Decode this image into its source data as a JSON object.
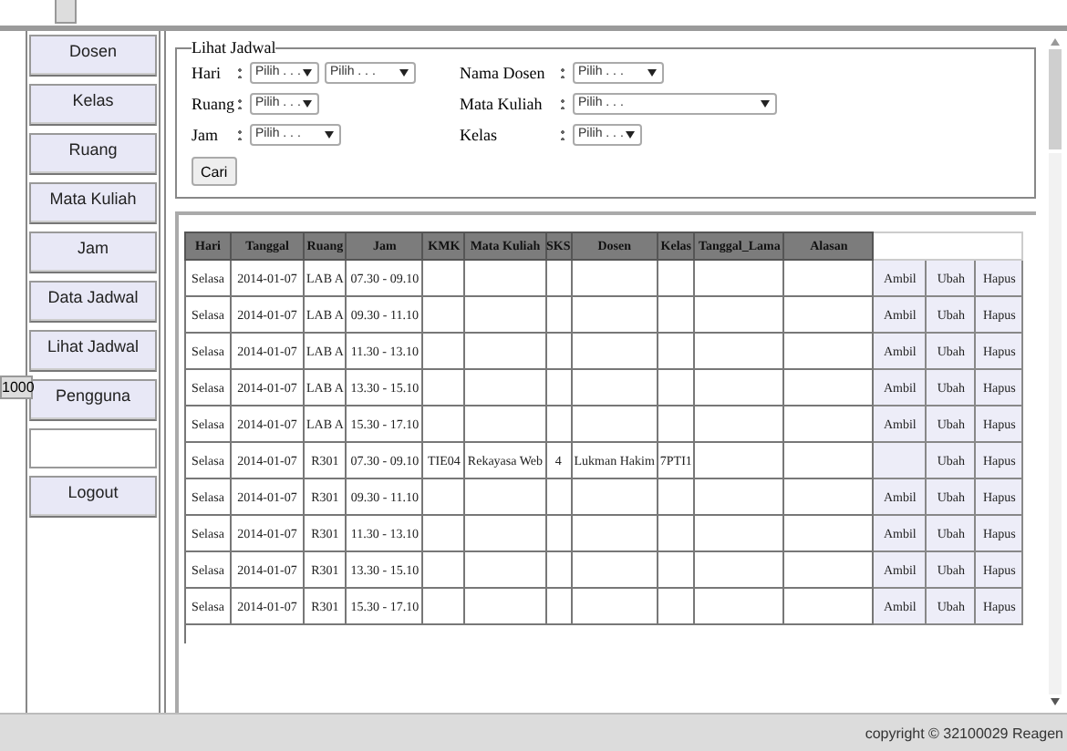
{
  "side_tab": "1000",
  "menu": [
    {
      "label": "Dosen",
      "kind": "link"
    },
    {
      "label": "Kelas",
      "kind": "link"
    },
    {
      "label": "Ruang",
      "kind": "link"
    },
    {
      "label": "Mata Kuliah",
      "kind": "link"
    },
    {
      "label": "Jam",
      "kind": "link"
    },
    {
      "label": "Data Jadwal",
      "kind": "link"
    },
    {
      "label": "Lihat Jadwal",
      "kind": "link"
    },
    {
      "label": "Pengguna",
      "kind": "link"
    },
    {
      "kind": "blank"
    },
    {
      "label": "Logout",
      "kind": "link"
    }
  ],
  "filter": {
    "legend": "Lihat Jadwal",
    "left": [
      {
        "label": "Hari",
        "selects": [
          {
            "value": "Pilih . . ."
          },
          {
            "value": "Pilih . . ."
          }
        ]
      },
      {
        "label": "Ruang",
        "selects": [
          {
            "value": "Pilih . . ."
          }
        ]
      },
      {
        "label": "Jam",
        "selects": [
          {
            "value": "Pilih . . ."
          }
        ]
      }
    ],
    "right": [
      {
        "label": "Nama Dosen",
        "selects": [
          {
            "value": "Pilih . . ."
          }
        ]
      },
      {
        "label": "Mata Kuliah",
        "selects": [
          {
            "value": "Pilih . . ."
          }
        ]
      },
      {
        "label": "Kelas",
        "selects": [
          {
            "value": "Pilih . . ."
          }
        ]
      }
    ],
    "button": "Cari"
  },
  "table": {
    "columns": [
      "Hari",
      "Tanggal",
      "Ruang",
      "Jam",
      "KMK",
      "Mata Kuliah",
      "SKS",
      "Dosen",
      "Kelas",
      "Tanggal_Lama",
      "Alasan"
    ],
    "rows": [
      {
        "cells": [
          "Selasa",
          "2014-01-07",
          "LAB A",
          "07.30 - 09.10",
          "",
          "",
          "",
          "",
          "",
          "",
          ""
        ],
        "actions": [
          "Ambil",
          "Ubah",
          "Hapus"
        ]
      },
      {
        "cells": [
          "Selasa",
          "2014-01-07",
          "LAB A",
          "09.30 - 11.10",
          "",
          "",
          "",
          "",
          "",
          "",
          ""
        ],
        "actions": [
          "Ambil",
          "Ubah",
          "Hapus"
        ]
      },
      {
        "cells": [
          "Selasa",
          "2014-01-07",
          "LAB A",
          "11.30 - 13.10",
          "",
          "",
          "",
          "",
          "",
          "",
          ""
        ],
        "actions": [
          "Ambil",
          "Ubah",
          "Hapus"
        ]
      },
      {
        "cells": [
          "Selasa",
          "2014-01-07",
          "LAB A",
          "13.30 - 15.10",
          "",
          "",
          "",
          "",
          "",
          "",
          ""
        ],
        "actions": [
          "Ambil",
          "Ubah",
          "Hapus"
        ]
      },
      {
        "cells": [
          "Selasa",
          "2014-01-07",
          "LAB A",
          "15.30 - 17.10",
          "",
          "",
          "",
          "",
          "",
          "",
          ""
        ],
        "actions": [
          "Ambil",
          "Ubah",
          "Hapus"
        ]
      },
      {
        "cells": [
          "Selasa",
          "2014-01-07",
          "R301",
          "07.30 - 09.10",
          "TIE04",
          "Rekayasa Web",
          "4",
          "Lukman Hakim",
          "7PTI1",
          "",
          ""
        ],
        "actions": [
          "Ubah",
          "Hapus"
        ]
      },
      {
        "cells": [
          "Selasa",
          "2014-01-07",
          "R301",
          "09.30 - 11.10",
          "",
          "",
          "",
          "",
          "",
          "",
          ""
        ],
        "actions": [
          "Ambil",
          "Ubah",
          "Hapus"
        ]
      },
      {
        "cells": [
          "Selasa",
          "2014-01-07",
          "R301",
          "11.30 - 13.10",
          "",
          "",
          "",
          "",
          "",
          "",
          ""
        ],
        "actions": [
          "Ambil",
          "Ubah",
          "Hapus"
        ]
      },
      {
        "cells": [
          "Selasa",
          "2014-01-07",
          "R301",
          "13.30 - 15.10",
          "",
          "",
          "",
          "",
          "",
          "",
          ""
        ],
        "actions": [
          "Ambil",
          "Ubah",
          "Hapus"
        ]
      },
      {
        "cells": [
          "Selasa",
          "2014-01-07",
          "R301",
          "15.30 - 17.10",
          "",
          "",
          "",
          "",
          "",
          "",
          ""
        ],
        "actions": [
          "Ambil",
          "Ubah",
          "Hapus"
        ]
      }
    ]
  },
  "footer": "copyright © 32100029 Reagen"
}
